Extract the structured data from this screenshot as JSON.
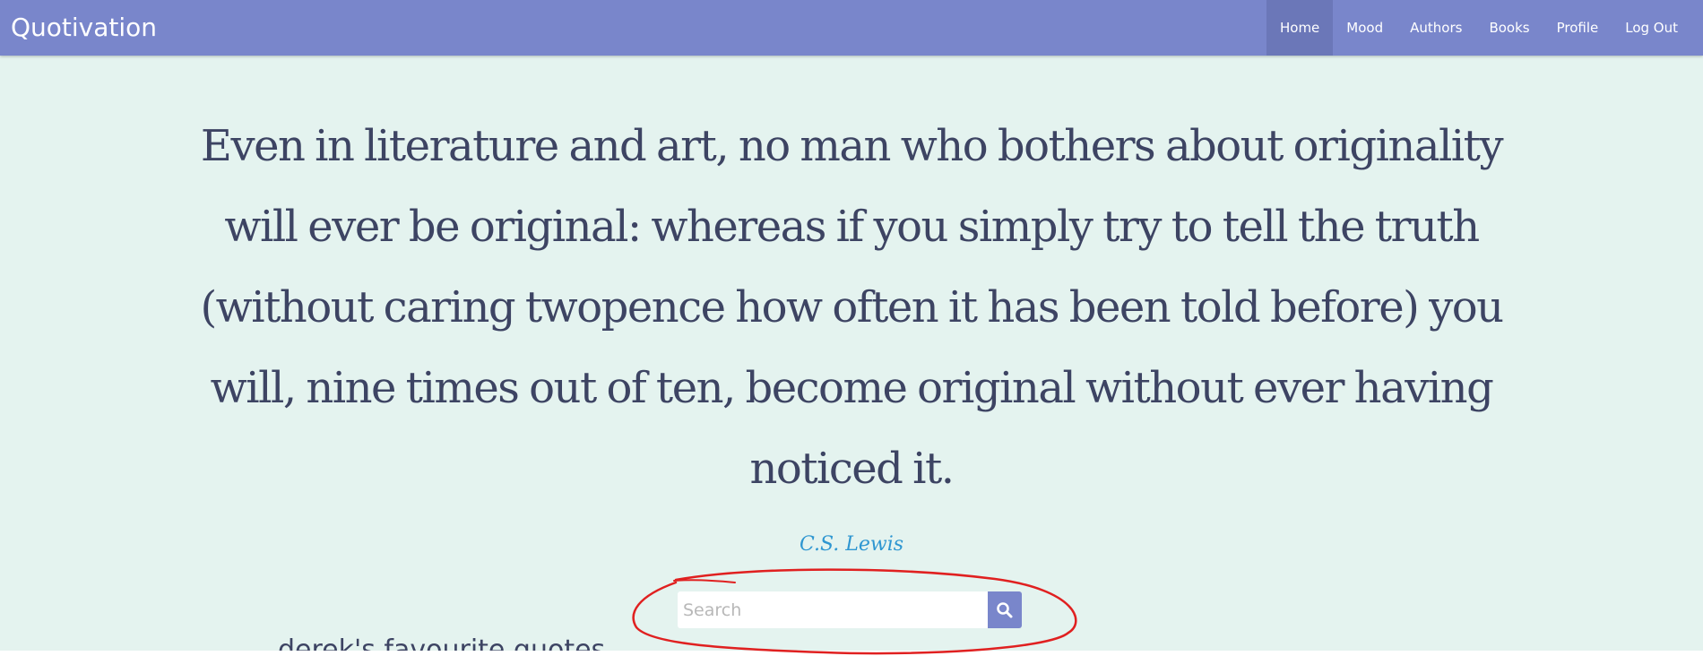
{
  "navbar": {
    "brand": "Quotivation",
    "items": [
      {
        "label": "Home",
        "active": true
      },
      {
        "label": "Mood",
        "active": false
      },
      {
        "label": "Authors",
        "active": false
      },
      {
        "label": "Books",
        "active": false
      },
      {
        "label": "Profile",
        "active": false
      },
      {
        "label": "Log Out",
        "active": false
      }
    ]
  },
  "quote": {
    "lines": [
      "Even in literature and art, no man who bothers about originality",
      "will ever be original: whereas if you simply try to tell the truth",
      "(without caring twopence how often it has been told before) you",
      "will, nine times out of ten, become original without ever having",
      "noticed it."
    ],
    "author": "C.S. Lewis"
  },
  "search": {
    "value": "",
    "placeholder": "Search",
    "button_icon": "search-icon"
  },
  "favourites": {
    "heading": "derek's favourite quotes"
  },
  "colors": {
    "navbar": "#7986cb",
    "background": "#e4f3ef",
    "quote_text": "#3d4463",
    "author_link": "#2e96d1",
    "annotation_circle": "#e02020"
  }
}
